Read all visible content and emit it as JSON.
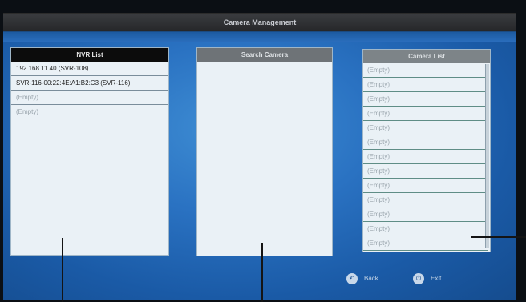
{
  "window": {
    "title": "Camera Management"
  },
  "nvr_list": {
    "header": "NVR List",
    "items": [
      {
        "label": "192.168.11.40 (SVR-108)",
        "empty": false
      },
      {
        "label": "SVR-116-00:22:4E:A1:B2:C3 (SVR-116)",
        "empty": false
      },
      {
        "label": "(Empty)",
        "empty": true
      },
      {
        "label": "(Empty)",
        "empty": true
      }
    ]
  },
  "search_camera": {
    "header": "Search Camera",
    "items": []
  },
  "camera_list": {
    "header": "Camera List",
    "items": [
      "(Empty)",
      "(Empty)",
      "(Empty)",
      "(Empty)",
      "(Empty)",
      "(Empty)",
      "(Empty)",
      "(Empty)",
      "(Empty)",
      "(Empty)",
      "(Empty)",
      "(Empty)",
      "(Empty)"
    ]
  },
  "buttons": {
    "back_label": "Back",
    "exit_label": "Exit"
  },
  "icons": {
    "back": "back-arrow-icon",
    "exit": "power-icon"
  }
}
